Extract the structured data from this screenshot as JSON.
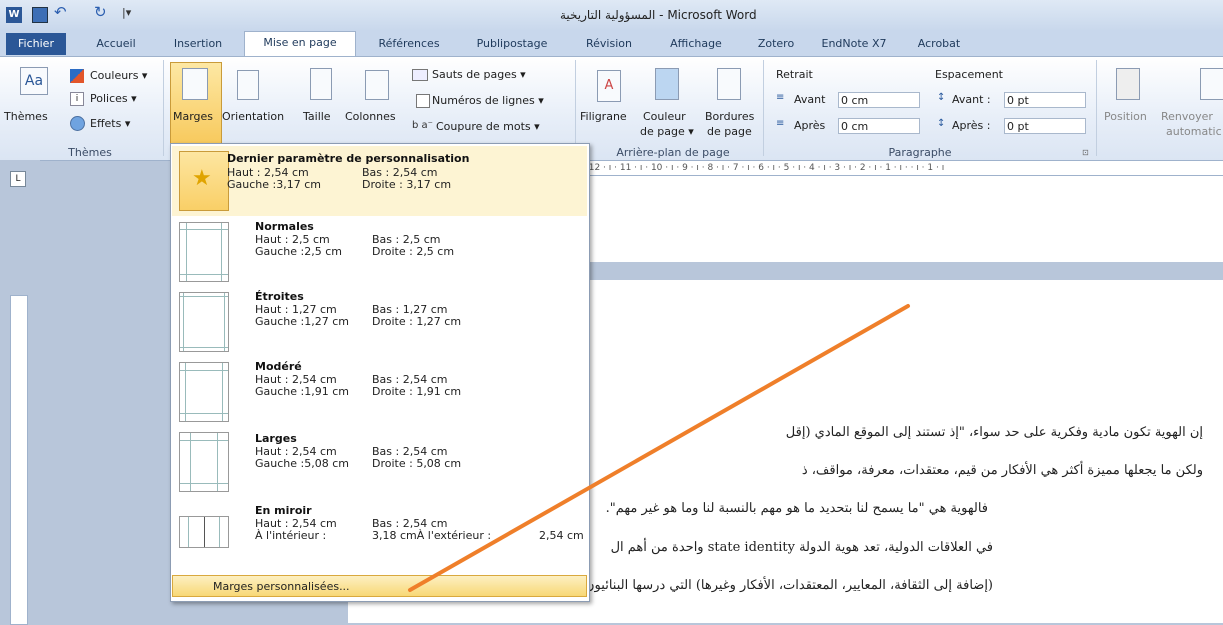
{
  "window": {
    "title": "المسؤولية التاريخية - Microsoft Word"
  },
  "tabs": [
    "Fichier",
    "Accueil",
    "Insertion",
    "Mise en page",
    "Références",
    "Publipostage",
    "Révision",
    "Affichage",
    "Zotero",
    "EndNote X7",
    "Acrobat"
  ],
  "ribbon": {
    "themes": {
      "label": "Thèmes",
      "couleurs": "Couleurs ▾",
      "polices": "Polices ▾",
      "effets": "Effets ▾",
      "group": "Thèmes"
    },
    "setup": {
      "marges": "Marges",
      "orientation": "Orientation",
      "taille": "Taille",
      "colonnes": "Colonnes",
      "sauts": "Sauts de pages ▾",
      "numeros": "Numéros de lignes ▾",
      "coupure": "Coupure de mots ▾"
    },
    "background": {
      "filigrane": "Filigrane",
      "couleur1": "Couleur",
      "couleur2": "de page ▾",
      "bordures1": "Bordures",
      "bordures2": "de page",
      "group": "Arrière-plan de page"
    },
    "paragraph": {
      "retrait": "Retrait",
      "avant_lbl": "Avant",
      "avant_val": "0 cm",
      "apres_lbl": "Après",
      "apres_val": "0 cm",
      "espacement": "Espacement",
      "esp_avant_lbl": "Avant :",
      "esp_avant_val": "0 pt",
      "esp_apres_lbl": "Après :",
      "esp_apres_val": "0 pt",
      "group": "Paragraphe"
    },
    "arrange": {
      "position": "Position",
      "renvoyer1": "Renvoyer",
      "renvoyer2": "automatic"
    }
  },
  "margins_menu": {
    "options": [
      {
        "title": "Dernier paramètre de personnalisation",
        "l1a": "Haut :   2,54 cm",
        "l1b": "Bas :     2,54 cm",
        "l2a": "Gauche :3,17 cm",
        "l2b": "Droite :  3,17 cm"
      },
      {
        "title": "Normales",
        "l1a": "Haut :   2,5 cm",
        "l1b": "Bas :     2,5 cm",
        "l2a": "Gauche :2,5 cm",
        "l2b": "Droite :  2,5 cm"
      },
      {
        "title": "Étroites",
        "l1a": "Haut :   1,27 cm",
        "l1b": "Bas :     1,27 cm",
        "l2a": "Gauche :1,27 cm",
        "l2b": "Droite :  1,27 cm"
      },
      {
        "title": "Modéré",
        "l1a": "Haut :   2,54 cm",
        "l1b": "Bas :     2,54 cm",
        "l2a": "Gauche :1,91 cm",
        "l2b": "Droite :  1,91 cm"
      },
      {
        "title": "Larges",
        "l1a": "Haut :   2,54 cm",
        "l1b": "Bas :     2,54 cm",
        "l2a": "Gauche :5,08 cm",
        "l2b": "Droite :  5,08 cm"
      },
      {
        "title": "En miroir",
        "l1a": "Haut :   2,54 cm",
        "l1b": "Bas :     2,54 cm",
        "l2a": "À l'intérieur :",
        "l2b": "3,18 cmÀ l'extérieur :",
        "l2c": "2,54 cm"
      }
    ],
    "custom": "Marges personnalisées..."
  },
  "ruler": {
    "h": "· 12 · ı · 11 · ı · 10 · ı · 9 · ı · 8 · ı · 7 · ı · 6 · ı · 5 · ı · 4 · ı · 3 · ı · 2 · ı · 1 · ı · · ı · 1 · ı"
  },
  "document": {
    "lines": [
      "إن الهوية تكون مادية وفكرية على حد سواء، \"إذ تستند إلى الموقع المادي (إقل",
      "ولكن ما يجعلها مميزة أكثر هي الأفكار من قيم، معتقدات، معرفة، مواقف، ذ",
      "فالهوية هي \"ما يسمح لنا بتحديد ما هو مهم بالنسبة لنا وما هو غير مهم\".",
      "في العلاقات الدولية، تعد هوية الدولة state identity واحدة من أهم ال",
      "(إضافة إلى الثقافة، المعايير، المعتقدات، الأفكار وغيرها) التي درسها البنائيون، والتي"
    ]
  },
  "colors": {
    "accent": "#2a5a9e",
    "file_tab": "#2b5797",
    "selected": "#fbe49b",
    "arrow": "#ef7f2a"
  }
}
